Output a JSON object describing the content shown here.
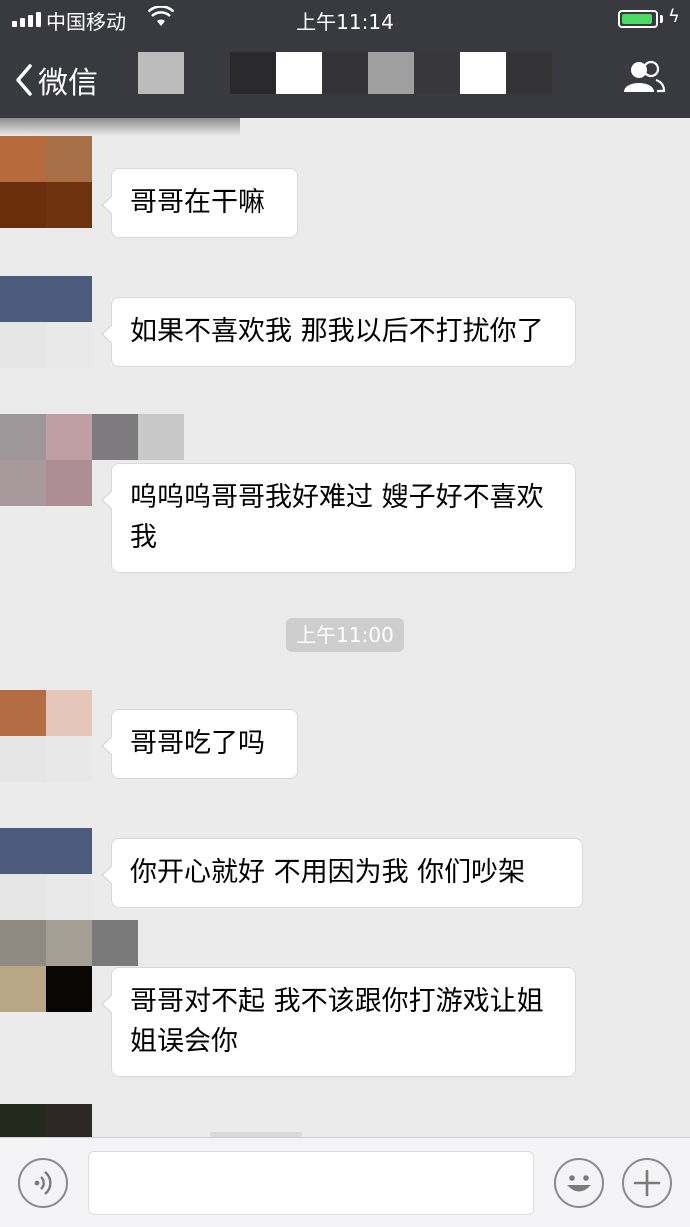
{
  "status_bar": {
    "carrier": "中国移动",
    "time": "上午11:14",
    "battery_level": 0.95,
    "signal_bars": 4
  },
  "nav": {
    "back_label": "微信",
    "contacts_icon": "contacts-icon",
    "back_icon": "chevron-left-icon"
  },
  "messages": [
    {
      "id": 1,
      "text": "哥哥在干嘛"
    },
    {
      "id": 2,
      "text": "如果不喜欢我 那我以后不打扰你了"
    },
    {
      "id": 3,
      "text": "呜呜呜哥哥我好难过 嫂子好不喜欢我"
    },
    {
      "id": 4,
      "text": "哥哥吃了吗"
    },
    {
      "id": 5,
      "text": "你开心就好 不用因为我 你们吵架"
    },
    {
      "id": 6,
      "text": "哥哥对不起 我不该跟你打游戏让姐姐误会你"
    }
  ],
  "timestamp": "上午11:00",
  "input_bar": {
    "voice_icon": "voice-icon",
    "emoji_icon": "emoji-icon",
    "plus_icon": "plus-icon",
    "input_value": ""
  },
  "colors": {
    "header_bg": "#393a3f",
    "chat_bg": "#ebebeb",
    "bubble_bg": "#ffffff",
    "battery_green": "#4cd964"
  }
}
